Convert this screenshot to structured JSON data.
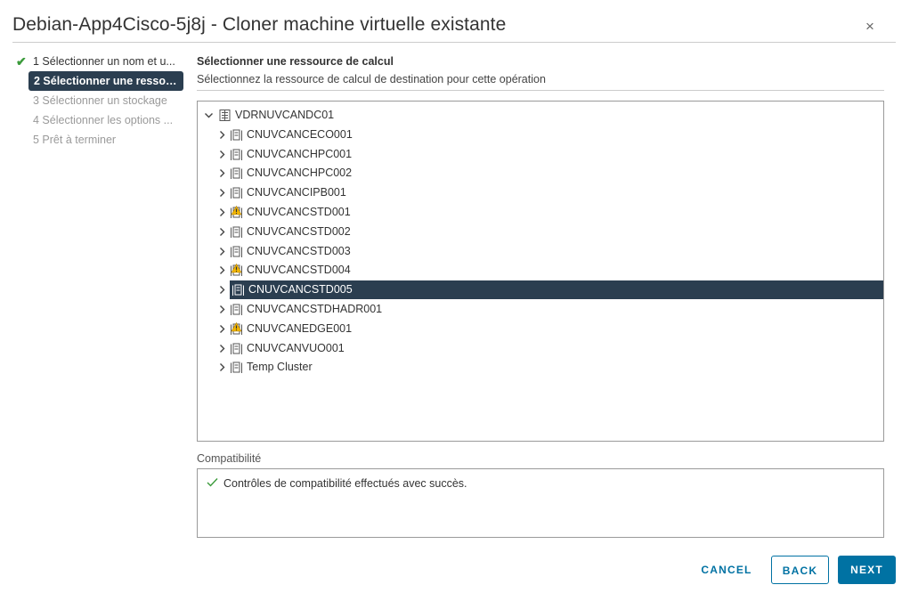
{
  "dialog": {
    "title": "Debian-App4Cisco-5j8j - Cloner machine virtuelle existante",
    "close_glyph": "×"
  },
  "steps": [
    {
      "label": "1 Sélectionner un nom et u...",
      "state": "done"
    },
    {
      "label": "2 Sélectionner une ressour...",
      "state": "active"
    },
    {
      "label": "3 Sélectionner un stockage",
      "state": "pending"
    },
    {
      "label": "4 Sélectionner les options ...",
      "state": "pending"
    },
    {
      "label": "5 Prêt à terminer",
      "state": "pending"
    }
  ],
  "section": {
    "title": "Sélectionner une ressource de calcul",
    "description": "Sélectionnez la ressource de calcul de destination pour cette opération"
  },
  "tree": {
    "root": {
      "label": "VDRNUVCANDC01",
      "icon": "datacenter-icon",
      "expanded": true
    },
    "clusters": [
      {
        "label": "CNUVCANCECO001",
        "warning": false,
        "selected": false
      },
      {
        "label": "CNUVCANCHPC001",
        "warning": false,
        "selected": false
      },
      {
        "label": "CNUVCANCHPC002",
        "warning": false,
        "selected": false
      },
      {
        "label": "CNUVCANCIPB001",
        "warning": false,
        "selected": false
      },
      {
        "label": "CNUVCANCSTD001",
        "warning": true,
        "selected": false
      },
      {
        "label": "CNUVCANCSTD002",
        "warning": false,
        "selected": false
      },
      {
        "label": "CNUVCANCSTD003",
        "warning": false,
        "selected": false
      },
      {
        "label": "CNUVCANCSTD004",
        "warning": true,
        "selected": false
      },
      {
        "label": "CNUVCANCSTD005",
        "warning": false,
        "selected": true
      },
      {
        "label": "CNUVCANCSTDHADR001",
        "warning": false,
        "selected": false
      },
      {
        "label": "CNUVCANEDGE001",
        "warning": true,
        "selected": false
      },
      {
        "label": "CNUVCANVUO001",
        "warning": false,
        "selected": false
      },
      {
        "label": "Temp Cluster",
        "warning": false,
        "selected": false
      }
    ]
  },
  "compatibility": {
    "label": "Compatibilité",
    "message": "Contrôles de compatibilité effectués avec succès.",
    "status_icon": "check-icon"
  },
  "buttons": {
    "cancel": "CANCEL",
    "back": "BACK",
    "next": "NEXT"
  },
  "colors": {
    "accent": "#0072a3",
    "selected_bg": "#2b3e50",
    "success": "#3b9b3b",
    "warning": "#f2b600"
  }
}
